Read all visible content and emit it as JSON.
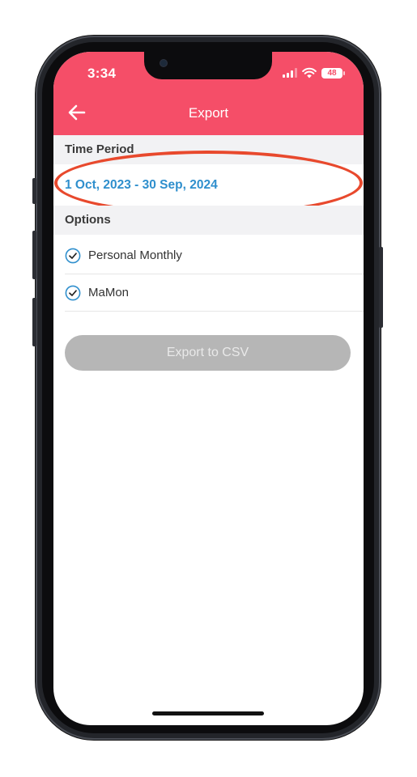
{
  "status_bar": {
    "time": "3:34",
    "battery": "48"
  },
  "header": {
    "title": "Export",
    "back_icon": "arrow-left-icon",
    "color": "#f54e68"
  },
  "time_period": {
    "section_label": "Time Period",
    "value": "1 Oct, 2023 - 30 Sep, 2024",
    "value_color": "#2f8fcd",
    "highlight_color": "#e8492d"
  },
  "options": {
    "section_label": "Options",
    "items": [
      {
        "label": "Personal Monthly",
        "checked": true,
        "icon": "check-circle-icon"
      },
      {
        "label": "MaMon",
        "checked": true,
        "icon": "check-circle-icon"
      }
    ],
    "check_color": "#2f8fcd"
  },
  "export_button": {
    "label": "Export to CSV",
    "enabled": false
  }
}
